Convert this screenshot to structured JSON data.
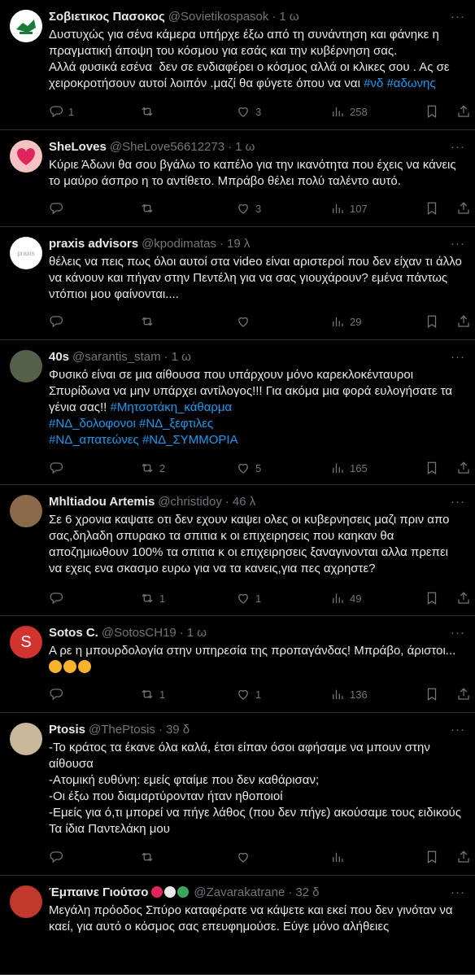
{
  "tweets": [
    {
      "name": "Σοβιετικος Πασοκος",
      "handle": "@Sovietikospasok",
      "time": "1 ω",
      "lines": [
        [
          {
            "t": "Δυστυχώς για σένα κάμερα υπήρχε έξω από τη συνάντηση και φάνηκε η"
          }
        ],
        [
          {
            "t": "πραγματική άποψη του κόσμου για εσάς και την κυβέρνηση σας."
          }
        ],
        [
          {
            "t": "Αλλά φυσικά εσένα  δεν σε ενδιαφέρει ο κόσμος αλλά οι κλικες σου . Ας σε"
          }
        ],
        [
          {
            "t": "χειροκροτήσουν αυτοί λοιπόν .μαζί θα φύγετε όπου να ναι "
          },
          {
            "t": "#νδ",
            "tag": true
          },
          {
            "t": " "
          },
          {
            "t": "#αδωνης",
            "tag": true
          }
        ]
      ],
      "replies": "1",
      "retweets": "",
      "likes": "3",
      "views": "258"
    },
    {
      "name": "SheLoves",
      "handle": "@SheLove56612273",
      "time": "1 ω",
      "lines": [
        [
          {
            "t": "Κύριε Άδωνι θα σου βγάλω το καπέλο για την ικανότητα που έχεις να κάνεις"
          }
        ],
        [
          {
            "t": "το μαύρο άσπρο η το αντίθετο. Μπράβο θέλει πολύ ταλέντο αυτό."
          }
        ]
      ],
      "replies": "",
      "retweets": "",
      "likes": "3",
      "views": "107"
    },
    {
      "name": "praxis advisors",
      "handle": "@kpodimatas",
      "time": "19 λ",
      "lines": [
        [
          {
            "t": "θέλεις να πεις πως όλοι αυτοί στα video είναι αριστεροί που δεν είχαν τι άλλο"
          }
        ],
        [
          {
            "t": "να κάνουν και πήγαν στην Πεντέλη για να σας γιουχάρουν? εμένα πάντως"
          }
        ],
        [
          {
            "t": "ντόπιοι μου φαίνονται...."
          }
        ]
      ],
      "avatar_text": "praxis",
      "replies": "",
      "retweets": "",
      "likes": "",
      "views": "29"
    },
    {
      "name": "40s",
      "handle": "@sarantis_stam",
      "time": "1 ω",
      "lines": [
        [
          {
            "t": "Φυσικό είναι σε μια αίθουσα που υπάρχουν μόνο καρεκλοκένταυροι"
          }
        ],
        [
          {
            "t": "Σπυρίδωνα να μην υπάρχει αντίλογος!!! Για ακόμα μια φορά ευλογήσατε τα"
          }
        ],
        [
          {
            "t": "γένια σας!! "
          },
          {
            "t": "#Μητσοτάκη_κάθαρμα",
            "tag": true
          }
        ],
        [
          {
            "t": "#ΝΔ_δολοφονοι",
            "tag": true
          },
          {
            "t": " "
          },
          {
            "t": "#ΝΔ_ξεφτιλες",
            "tag": true
          }
        ],
        [
          {
            "t": "#ΝΔ_απατεώνες",
            "tag": true
          },
          {
            "t": " "
          },
          {
            "t": "#ΝΔ_ΣΥΜΜΟΡΙΑ",
            "tag": true
          }
        ]
      ],
      "replies": "",
      "retweets": "2",
      "likes": "5",
      "views": "165"
    },
    {
      "name": "Mhltiadou Artemis",
      "handle": "@christidoy",
      "time": "46 λ",
      "lines": [
        [
          {
            "t": "Σε 6 χρονια καψατε οτι δεν εχουν καψει ολες οι κυβερνησεις μαζι πριν απο"
          }
        ],
        [
          {
            "t": "σας,δηλαδη σπυρακο τα σπιτια κ οι επιχειρησεις που καηκαν θα"
          }
        ],
        [
          {
            "t": "αποζημιωθουν 100% τα σπιτια κ οι επιχειρησεις ξαναγινονται αλλα πρεπει"
          }
        ],
        [
          {
            "t": "να εχεις ενα σκασμο ευρω για να τα κανεις,για πες αχρηστε?"
          }
        ]
      ],
      "replies": "",
      "retweets": "1",
      "likes": "1",
      "views": "49"
    },
    {
      "name": "Sotos C.",
      "handle": "@SotosCH19",
      "time": "1 ω",
      "lines": [
        [
          {
            "t": "Α ρε η μπουρδολογία στην υπηρεσία της προπαγάνδας! Μπράβο, άριστοι..."
          }
        ]
      ],
      "emojis": [
        "#f7b32b",
        "#f7b32b",
        "#f7b32b"
      ],
      "avatar_text": "S",
      "replies": "",
      "retweets": "1",
      "likes": "1",
      "views": "136"
    },
    {
      "name": "Ptosis",
      "handle": "@ThePtosis",
      "time": "39 δ",
      "lines": [
        [
          {
            "t": "-Το κράτος τα έκανε όλα καλά, έτσι είπαν όσοι αφήσαμε να μπουν στην"
          }
        ],
        [
          {
            "t": "αίθουσα"
          }
        ],
        [
          {
            "t": "-Ατομική ευθύνη: εμείς φταίμε που δεν καθάρισαν;"
          }
        ],
        [
          {
            "t": "-Οι έξω που διαμαρτύρονταν ήταν ηθοποιοί"
          }
        ],
        [
          {
            "t": "-Εμείς για ό,τι μπορεί να πήγε λάθος (που δεν πήγε) ακούσαμε τους ειδικούς"
          }
        ],
        [
          {
            "t": "Τα ίδια Παντελάκη μου"
          }
        ]
      ],
      "replies": "",
      "retweets": "",
      "likes": "",
      "views": ""
    },
    {
      "name": "Έμπαινε Γιούτσο",
      "handle": "@Zavarakatrane",
      "time": "32 δ",
      "lines": [
        [
          {
            "t": "Μεγάλη πρόοδος Σπύρο καταφέρατε να κάψετε και εκεί που δεν γινόταν να"
          }
        ],
        [
          {
            "t": "καεί, για αυτό ο κόσμος σας επευφημούσε. Εύγε μόνο αλήθειες"
          }
        ]
      ],
      "name_emojis": [
        "#e0245e",
        "#e7e9ea",
        "#3ba55d"
      ],
      "replies": "",
      "retweets": "",
      "likes": "",
      "views": ""
    }
  ],
  "icons": [
    "reply-icon",
    "retweet-icon",
    "like-icon",
    "views-icon",
    "bookmark-icon",
    "share-icon",
    "more-icon"
  ]
}
